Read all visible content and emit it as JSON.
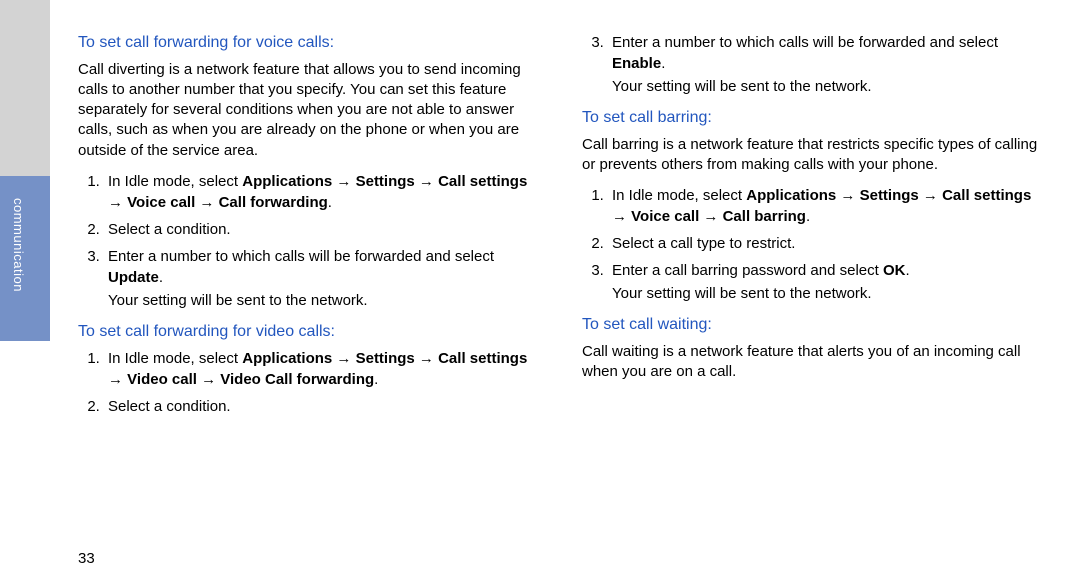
{
  "side_label": "communication",
  "page_number": "33",
  "arrow": "→",
  "left": {
    "h1": "To set call forwarding for voice calls:",
    "p1": "Call diverting is a network feature that allows you to send incoming calls to another number that you specify. You can set this feature separately for several conditions when you are not able to answer calls, such as when you are already on the phone or when you are outside of the service area.",
    "s1_pre": "In Idle mode, select ",
    "s1_path": "Applications → Settings → Call settings → Voice call → Call forwarding",
    "s1_post": ".",
    "s2": "Select a condition.",
    "s3_pre": "Enter a number to which calls will be forwarded and select ",
    "s3_bold": "Update",
    "s3_post": ".",
    "s3_sub": "Your setting will be sent to the network.",
    "h2": "To set call forwarding for video calls:",
    "v1_pre": "In Idle mode, select ",
    "v1_path": "Applications → Settings → Call settings → Video call → Video Call forwarding",
    "v1_post": ".",
    "v2": "Select a condition."
  },
  "right": {
    "c3_pre": "Enter a number to which calls will be forwarded and select ",
    "c3_bold": "Enable",
    "c3_post": ".",
    "c3_sub": "Your setting will be sent to the network.",
    "h1": "To set call barring:",
    "p1": "Call barring is a network feature that restricts specific types of calling or prevents others from making calls with your phone.",
    "b1_pre": "In Idle mode, select ",
    "b1_path": "Applications → Settings → Call settings → Voice call → Call barring",
    "b1_post": ".",
    "b2": "Select a call type to restrict.",
    "b3_pre": "Enter a call barring password and select ",
    "b3_bold": "OK",
    "b3_post": ".",
    "b3_sub": "Your setting will be sent to the network.",
    "h2": "To set call waiting:",
    "p2": "Call waiting is a network feature that alerts you of an incoming call when you are on a call."
  }
}
